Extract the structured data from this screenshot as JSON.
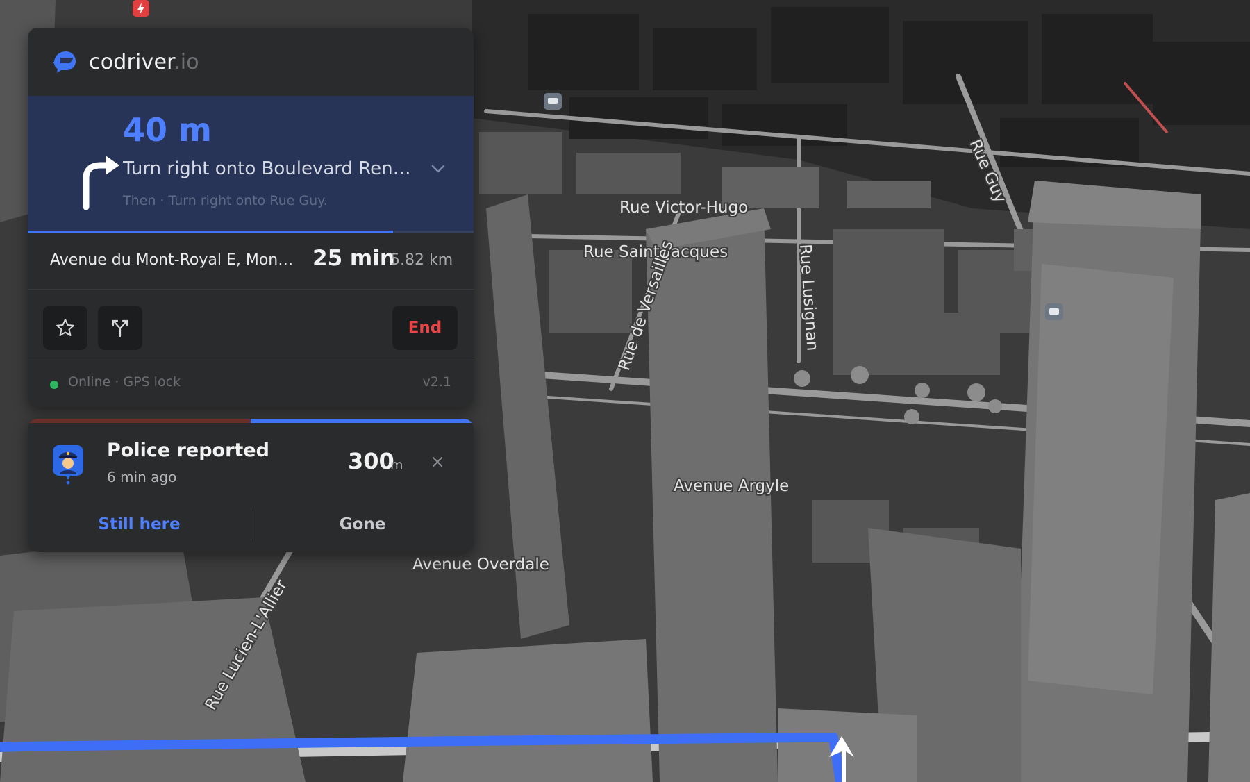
{
  "colors": {
    "accent": "#3f74f5",
    "danger": "#e84646",
    "online": "#2fb55f",
    "panel": "#2a2b2d",
    "maneuver_bg": "#283457"
  },
  "app": {
    "brand_name": "codriver",
    "brand_tld": ".io",
    "logo_icon": "helmet-logo-icon"
  },
  "navigation": {
    "distance": "40 m",
    "instruction": "Turn right onto Boulevard René-Lévesque O",
    "then": "Then · Turn right onto Rue Guy.",
    "maneuver_icon": "turn-right-arrow-icon",
    "progress": 0.82
  },
  "route": {
    "destination": "Avenue du Mont-Royal E, Montréal",
    "eta": "25 min",
    "distance": "5.82 km"
  },
  "actions": {
    "favorite_icon": "star-icon",
    "alternate_icon": "route-fork-icon",
    "end_label": "End"
  },
  "status": {
    "text": "Online · GPS lock",
    "version": "v2.1"
  },
  "alert": {
    "title": "Police reported",
    "time": "6 min ago",
    "distance_value": "300",
    "distance_unit": "m",
    "still_label": "Still here",
    "gone_label": "Gone",
    "icon": "police-officer-icon",
    "timer_remaining": 0.5
  },
  "map": {
    "streets": [
      "Rue Victor-Hugo",
      "Rue Saint-Jacques",
      "Rue de Versailles",
      "Rue Lusignan",
      "Rue Guy",
      "Avenue Argyle",
      "Avenue Overdale",
      "Rue Lucien-L'Allier"
    ]
  }
}
